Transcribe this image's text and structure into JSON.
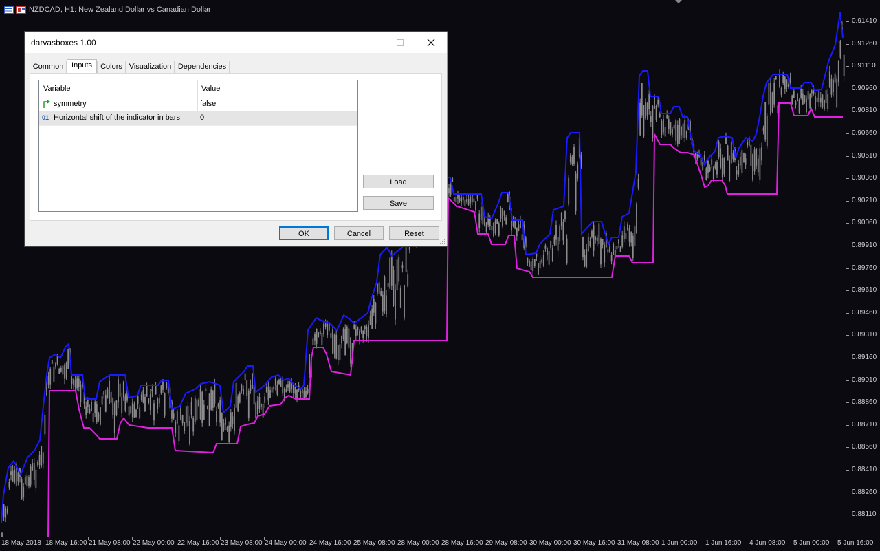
{
  "chart": {
    "header": "NZDCAD, H1:  New Zealand Dollar vs Canadian Dollar",
    "price_labels": [
      "0.91410",
      "0.91260",
      "0.91110",
      "0.90960",
      "0.90810",
      "0.90660",
      "0.90510",
      "0.90360",
      "0.90210",
      "0.90060",
      "0.89910",
      "0.89760",
      "0.89610",
      "0.89460",
      "0.89310",
      "0.89160",
      "0.89010",
      "0.88860",
      "0.88710",
      "0.88560",
      "0.88410",
      "0.88260",
      "0.88110"
    ],
    "time_labels": [
      "18 May 2018",
      "18 May 16:00",
      "21 May 08:00",
      "22 May 00:00",
      "22 May 16:00",
      "23 May 08:00",
      "24 May 00:00",
      "24 May 16:00",
      "25 May 08:00",
      "28 May 00:00",
      "28 May 16:00",
      "29 May 08:00",
      "30 May 00:00",
      "30 May 16:00",
      "31 May 08:00",
      "1 Jun 00:00",
      "1 Jun 16:00",
      "4 Jun 08:00",
      "5 Jun 00:00",
      "5 Jun 16:00"
    ],
    "colors": {
      "background": "#0b0a11",
      "candles": "#8c8c8c",
      "upper_line": "#1a1aff",
      "lower_line": "#e020e0"
    }
  },
  "dialog": {
    "title": "darvasboxes 1.00",
    "tabs": [
      {
        "label": "Common"
      },
      {
        "label": "Inputs"
      },
      {
        "label": "Colors"
      },
      {
        "label": "Visualization"
      },
      {
        "label": "Dependencies"
      }
    ],
    "active_tab": "Inputs",
    "grid": {
      "col_variable": "Variable",
      "col_value": "Value",
      "rows": [
        {
          "icon": "bool-arrow-icon",
          "variable": "symmetry",
          "value": "false"
        },
        {
          "icon": "integer-01-icon",
          "icon_text": "01",
          "variable": "Horizontal shift of the indicator in bars",
          "value": "0"
        }
      ]
    },
    "buttons": {
      "load": "Load",
      "save": "Save",
      "ok": "OK",
      "cancel": "Cancel",
      "reset": "Reset"
    }
  }
}
